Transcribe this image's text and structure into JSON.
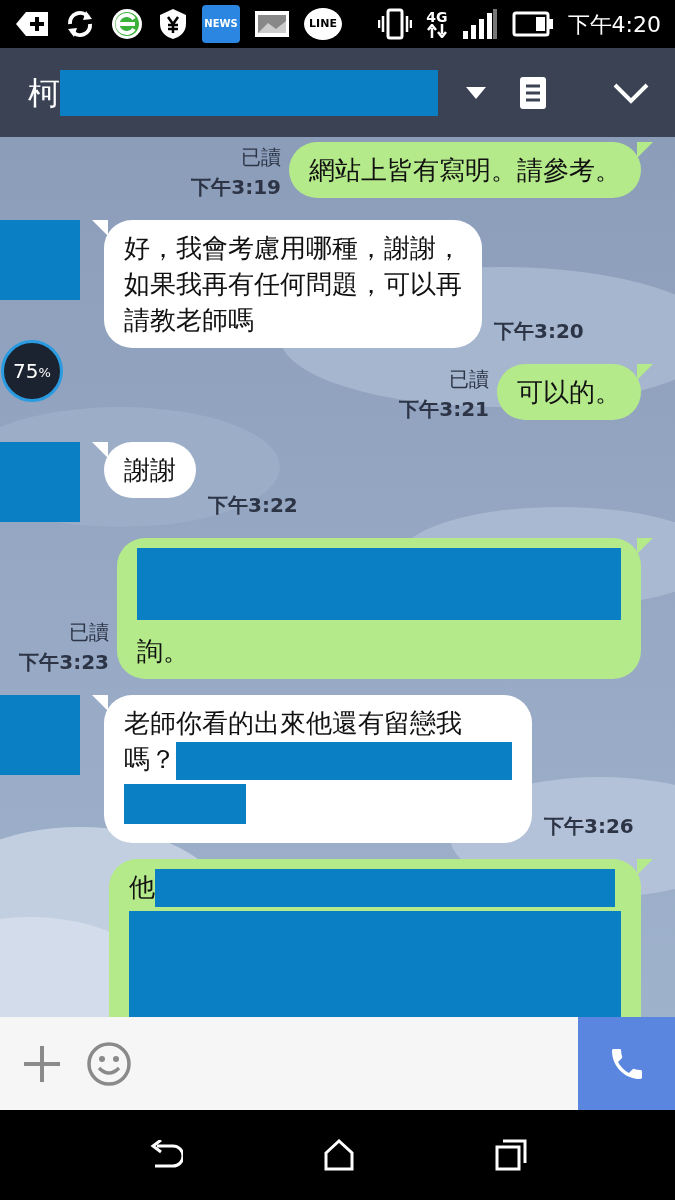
{
  "status_bar": {
    "news_label": "NEWS",
    "line_label": "LINE",
    "network": "4G",
    "time": "下午4:20"
  },
  "header": {
    "title": "柯"
  },
  "overlay_badge": {
    "value": "75",
    "unit": "%"
  },
  "messages": [
    {
      "kind": "sent",
      "read_label": "已讀",
      "time": "下午3:19",
      "parts": [
        {
          "kind": "text",
          "text": "網站上皆有寫明。請參考。"
        }
      ]
    },
    {
      "kind": "received",
      "time": "下午3:20",
      "parts": [
        {
          "kind": "text",
          "text": "好，我會考慮用哪種，謝謝，"
        },
        {
          "kind": "break"
        },
        {
          "kind": "text",
          "text": "如果我再有任何問題，可以再"
        },
        {
          "kind": "break"
        },
        {
          "kind": "text",
          "text": "請教老師嗎"
        }
      ]
    },
    {
      "kind": "sent",
      "read_label": "已讀",
      "time": "下午3:21",
      "parts": [
        {
          "kind": "text",
          "text": "可以的。"
        }
      ]
    },
    {
      "kind": "received",
      "time": "下午3:22",
      "parts": [
        {
          "kind": "text",
          "text": "謝謝"
        }
      ]
    },
    {
      "kind": "sent",
      "read_label": "已讀",
      "time": "下午3:23",
      "parts": [
        {
          "kind": "block"
        },
        {
          "kind": "break"
        },
        {
          "kind": "text",
          "text": "詢。"
        }
      ]
    },
    {
      "kind": "received",
      "time": "下午3:26",
      "parts": [
        {
          "kind": "text",
          "text": "老師你看的出來他還有留戀我"
        },
        {
          "kind": "break"
        },
        {
          "kind": "text",
          "text": "嗎？"
        },
        {
          "kind": "bar"
        },
        {
          "kind": "break"
        },
        {
          "kind": "stub"
        }
      ]
    },
    {
      "kind": "sent",
      "parts": [
        {
          "kind": "text",
          "text": "他"
        },
        {
          "kind": "line"
        },
        {
          "kind": "break"
        },
        {
          "kind": "slab"
        }
      ]
    }
  ]
}
